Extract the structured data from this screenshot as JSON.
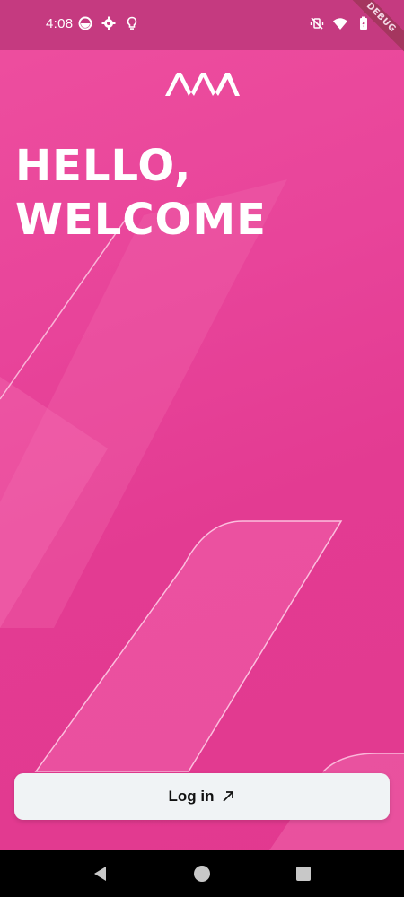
{
  "status_bar": {
    "time": "4:08",
    "debug_label": "DEBUG",
    "left_icons": [
      "app-circle-icon",
      "gear-icon",
      "lightbulb-icon"
    ],
    "right_icons": [
      "vibrate-off-icon",
      "wifi-icon",
      "battery-icon"
    ]
  },
  "brand": {
    "logo_icon": "brand-logo-icon"
  },
  "welcome": {
    "line1": "HELLO,",
    "line2": "WELCOME"
  },
  "actions": {
    "login_label": "Log in",
    "login_icon": "arrow-up-right-icon"
  },
  "nav": {
    "icons": [
      "back-icon",
      "home-icon",
      "recents-icon"
    ]
  },
  "colors": {
    "background": "#e8449a",
    "status_bar": "#c53a80",
    "button_bg": "#f0f3f5",
    "text_light": "#ffffff"
  }
}
